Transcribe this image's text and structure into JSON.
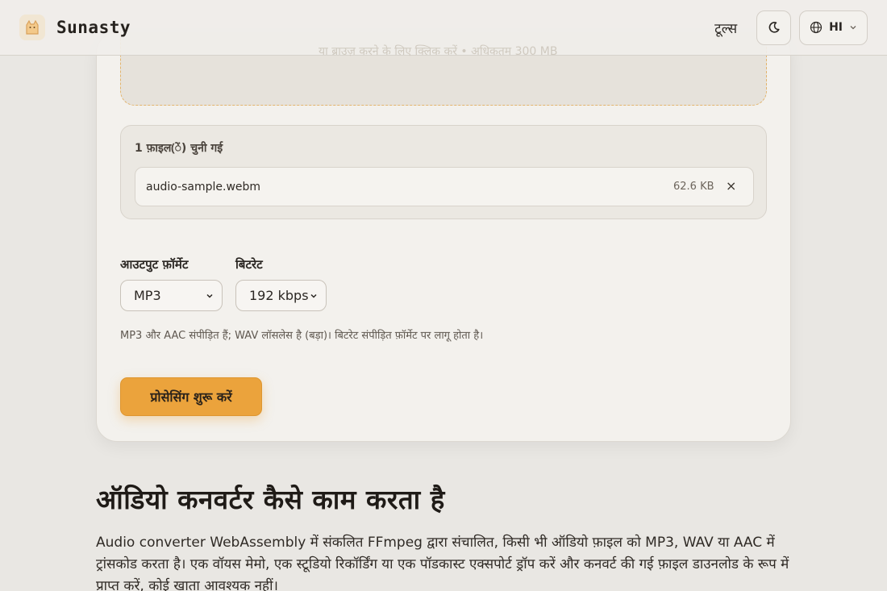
{
  "header": {
    "brand": "Sunasty",
    "nav_tools": "टूल्स",
    "language": "HI"
  },
  "upload": {
    "hint_faded": "या ब्राउज़ करने के लिए क्लिक करें • अधिकतम 300 MB"
  },
  "files": {
    "title": "1 फ़ाइल(ें) चुनी गई",
    "items": [
      {
        "name": "audio-sample.webm",
        "size": "62.6 KB",
        "remove": "×"
      }
    ]
  },
  "options": {
    "format_label": "आउटपुट फ़ॉर्मेट",
    "format_value": "MP3",
    "bitrate_label": "बिटरेट",
    "bitrate_value": "192 kbps",
    "hint": "MP3 और AAC संपीड़ित हैं; WAV लॉसलेस है (बड़ा)। बिटरेट संपीड़ित फ़ॉर्मेट पर लागू होता है।"
  },
  "actions": {
    "start": "प्रोसेसिंग शुरू करें"
  },
  "about": {
    "title": "ऑडियो कनवर्टर कैसे काम करता है",
    "body": "Audio converter WebAssembly में संकलित FFmpeg द्वारा संचालित, किसी भी ऑडियो फ़ाइल को MP3, WAV या AAC में ट्रांसकोड करता है। एक वॉयस मेमो, एक स्टूडियो रिकॉर्डिंग या एक पॉडकास्ट एक्सपोर्ट ड्रॉप करें और कनवर्ट की गई फ़ाइल डाउनलोड के रूप में प्राप्त करें, कोई खाता आवश्यक नहीं।"
  },
  "colors": {
    "accent": "#eba33c",
    "background": "#e9e7e3",
    "card": "#f3f1ed"
  }
}
